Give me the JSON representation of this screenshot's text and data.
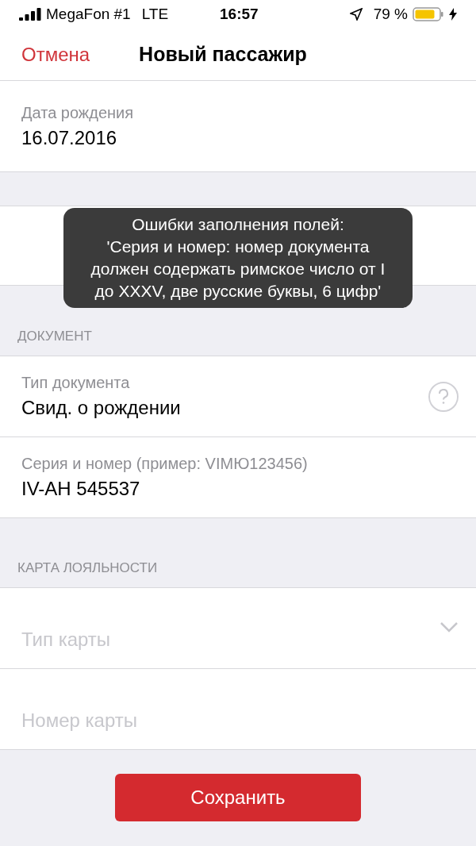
{
  "status_bar": {
    "carrier": "MegaFon #1",
    "network": "LTE",
    "time": "16:57",
    "battery_percent": "79 %",
    "charging": true
  },
  "nav": {
    "cancel": "Отмена",
    "title": "Новый пассажир"
  },
  "birth_date": {
    "label": "Дата рождения",
    "value": "16.07.2016"
  },
  "toast": {
    "title": "Ошибки заполнения полей:",
    "message": "'Серия и номер: номер документа должен содержать римское число от I до XXXV, две русские буквы, 6 цифр'"
  },
  "sections": [
    {
      "header": "ДОКУМЕНТ",
      "fields": [
        {
          "kind": "help",
          "label": "Тип документа",
          "value": "Свид. о рождении"
        },
        {
          "kind": "text",
          "label": "Серия и номер (пример: VIMЮ123456)",
          "value": "IV-AH 545537"
        }
      ]
    },
    {
      "header": "КАРТА ЛОЯЛЬНОСТИ",
      "fields": [
        {
          "kind": "select",
          "placeholder": "Тип карты"
        },
        {
          "kind": "input",
          "placeholder": "Номер карты"
        }
      ]
    }
  ],
  "save_button": "Сохранить"
}
